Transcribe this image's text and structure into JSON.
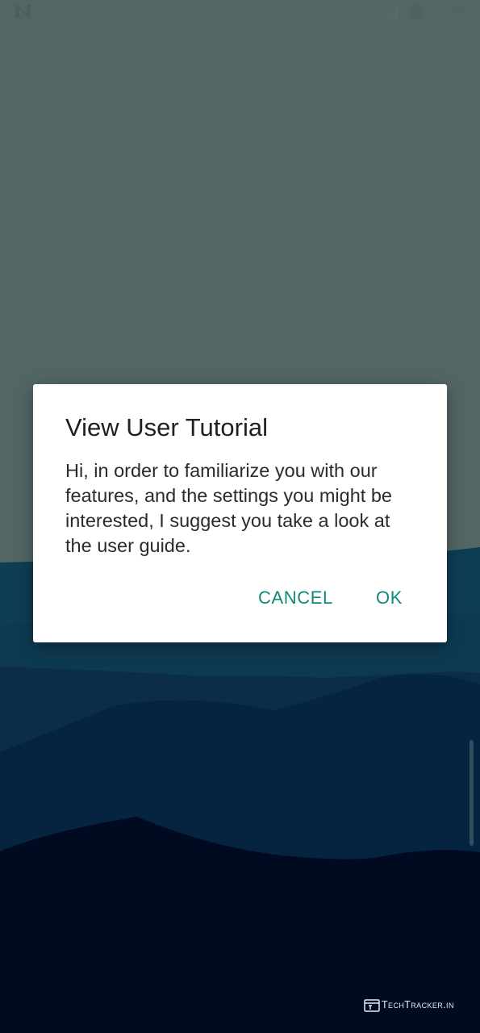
{
  "status_bar": {
    "time": "1:51",
    "icons": [
      "n-notification-icon",
      "signal-icon",
      "battery-icon"
    ]
  },
  "dialog": {
    "title": "View User Tutorial",
    "message": "Hi, in order to familiarize you with our features, and the settings you might be interested, I suggest you take a look at the user guide.",
    "buttons": {
      "cancel": "CANCEL",
      "ok": "OK"
    }
  },
  "watermark": {
    "text": "TechTracker.in"
  },
  "colors": {
    "accent": "#10897b",
    "dialog_background": "#ffffff",
    "sky": "#526565",
    "deep_background": "#000b22"
  }
}
